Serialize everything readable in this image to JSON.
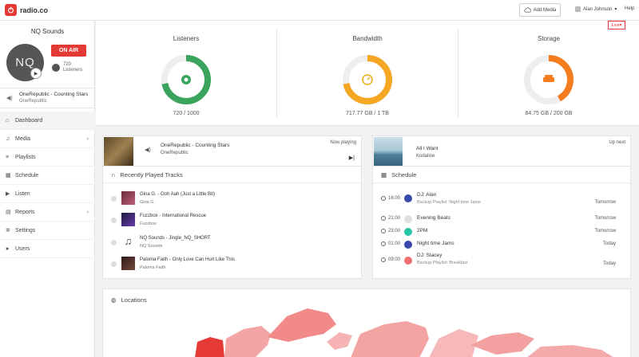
{
  "header": {
    "logo_text": "radio.co",
    "add_media_label": "Add Media",
    "user_name": "Alan Johnson",
    "help_label": "Help"
  },
  "sidebar": {
    "station_name": "NQ Sounds",
    "avatar_initials": "NQ",
    "on_air_label": "ON AIR",
    "listeners_count": "720",
    "listeners_label": "Listeners",
    "now_playing_title": "OneRepublic - Counting Stars",
    "now_playing_artist": "OneRepublic",
    "nav": [
      {
        "label": "Dashboard",
        "icon": "home-icon"
      },
      {
        "label": "Media",
        "icon": "music-icon"
      },
      {
        "label": "Playlists",
        "icon": "list-icon"
      },
      {
        "label": "Schedule",
        "icon": "calendar-icon"
      },
      {
        "label": "Listen",
        "icon": "play-icon"
      },
      {
        "label": "Reports",
        "icon": "reports-icon"
      },
      {
        "label": "Settings",
        "icon": "gear-icon"
      },
      {
        "label": "Users",
        "icon": "user-icon"
      }
    ]
  },
  "stats": {
    "live_label": "Live",
    "listeners": {
      "title": "Listeners",
      "value": "720 / 1000",
      "fraction": 0.72,
      "color": "#3aa35c"
    },
    "bandwidth": {
      "title": "Bandwidth",
      "value": "717.77 GB / 1 TB",
      "fraction": 0.72,
      "color": "#f5a623"
    },
    "storage": {
      "title": "Storage",
      "value": "84.75 GB / 200 GB",
      "fraction": 0.42,
      "color": "#f57c1f"
    }
  },
  "now_playing_card": {
    "title": "OneRepublic - Counting Stars",
    "artist": "OneRepublic",
    "label": "Now playing"
  },
  "up_next_card": {
    "title": "All I Want",
    "artist": "Kodaline",
    "label": "Up next"
  },
  "recent": {
    "heading": "Recently Played Tracks",
    "items": [
      {
        "title": "Gina G. - Ooh Aah (Just a Little Bit)",
        "artist": "Gina G."
      },
      {
        "title": "Fuzzbox - International Rescue",
        "artist": "Fuzzbox"
      },
      {
        "title": "NQ Sounds - Jingle_NQ_SHORT",
        "artist": "NQ Sounds"
      },
      {
        "title": "Paloma Faith - Only Love Can Hurt Like This",
        "artist": "Paloma Faith"
      }
    ]
  },
  "schedule": {
    "heading": "Schedule",
    "items": [
      {
        "time": "16:00",
        "title": "DJ: Alan",
        "sub": "Backup Playlist: Night time Jams",
        "day": "Tomorrow",
        "color": "#3949ab"
      },
      {
        "time": "21:00",
        "title": "Evening Beats",
        "sub": "",
        "day": "Tomorrow",
        "color": "#e0e0e0"
      },
      {
        "time": "23:00",
        "title": "2PM",
        "sub": "",
        "day": "Tomorrow",
        "color": "#26c6a6"
      },
      {
        "time": "01:00",
        "title": "Night time Jams",
        "sub": "",
        "day": "Today",
        "color": "#3949ab"
      },
      {
        "time": "09:00",
        "title": "DJ: Stacey",
        "sub": "Backup Playlist: Breakfast",
        "day": "Today",
        "color": "#ef6f6f"
      }
    ]
  },
  "locations": {
    "heading": "Locations"
  }
}
